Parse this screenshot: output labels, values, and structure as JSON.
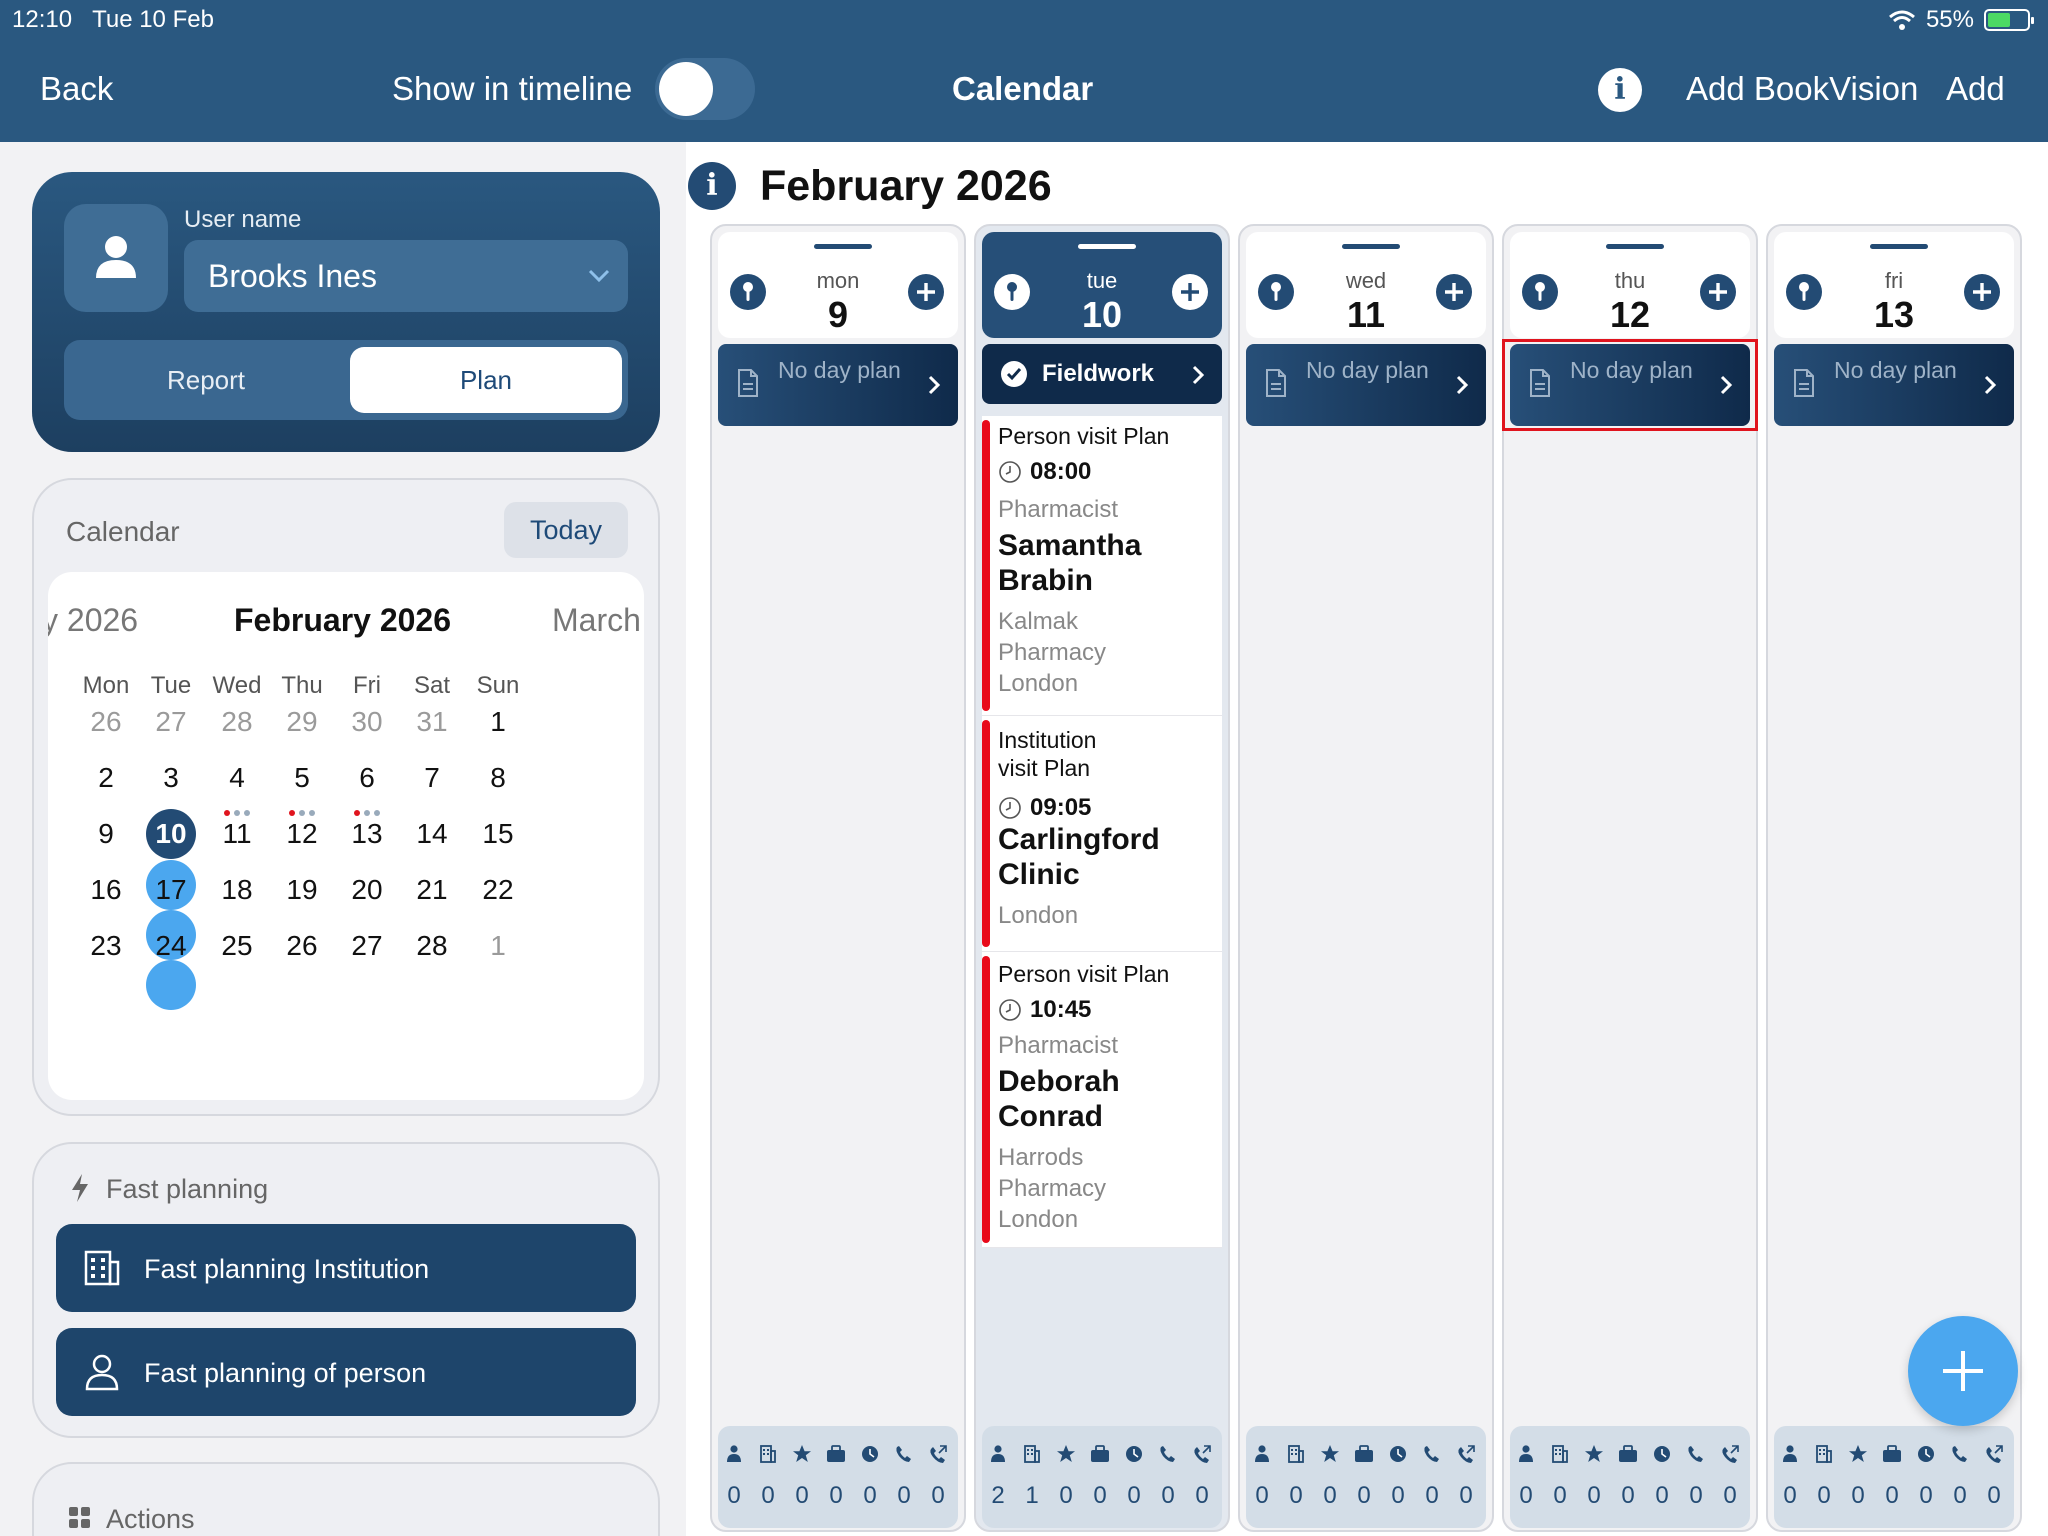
{
  "status_bar": {
    "time": "12:10",
    "date": "Tue 10 Feb",
    "battery": "55%"
  },
  "nav": {
    "back": "Back",
    "show_in_timeline": "Show in timeline",
    "title": "Calendar",
    "add_bookvision": "Add BookVision",
    "add": "Add"
  },
  "user_card": {
    "label": "User name",
    "value": "Brooks Ines",
    "segments": [
      "Report",
      "Plan"
    ],
    "selected_segment": "Plan"
  },
  "calendar_card": {
    "title": "Calendar",
    "today_button": "Today",
    "prev_month": "y 2026",
    "current_month": "February 2026",
    "next_month": "March",
    "weekdays": [
      "Mon",
      "Tue",
      "Wed",
      "Thu",
      "Fri",
      "Sat",
      "Sun"
    ],
    "weeks": [
      [
        "26",
        "27",
        "28",
        "29",
        "30",
        "31",
        "1"
      ],
      [
        "2",
        "3",
        "4",
        "5",
        "6",
        "7",
        "8"
      ],
      [
        "9",
        "10",
        "11",
        "12",
        "13",
        "14",
        "15"
      ],
      [
        "16",
        "17",
        "18",
        "19",
        "20",
        "21",
        "22"
      ],
      [
        "23",
        "24",
        "25",
        "26",
        "27",
        "28",
        "1"
      ]
    ]
  },
  "fast_planning": {
    "title": "Fast planning",
    "institution_button": "Fast planning Institution",
    "person_button": "Fast planning of person"
  },
  "actions": {
    "title": "Actions"
  },
  "week_view": {
    "title": "February 2026",
    "days": [
      {
        "weekday": "mon",
        "num": "9",
        "plan": "No day plan",
        "stats": [
          "0",
          "0",
          "0",
          "0",
          "0",
          "0",
          "0"
        ]
      },
      {
        "weekday": "tue",
        "num": "10",
        "plan": "Fieldwork",
        "stats": [
          "2",
          "1",
          "0",
          "0",
          "0",
          "0",
          "0"
        ]
      },
      {
        "weekday": "wed",
        "num": "11",
        "plan": "No day plan",
        "stats": [
          "0",
          "0",
          "0",
          "0",
          "0",
          "0",
          "0"
        ]
      },
      {
        "weekday": "thu",
        "num": "12",
        "plan": "No day plan",
        "stats": [
          "0",
          "0",
          "0",
          "0",
          "0",
          "0",
          "0"
        ]
      },
      {
        "weekday": "fri",
        "num": "13",
        "plan": "No day plan",
        "stats": [
          "0",
          "0",
          "0",
          "0",
          "0",
          "0",
          "0"
        ]
      }
    ],
    "visits": [
      {
        "type": "Person visit Plan",
        "time": "08:00",
        "role": "Pharmacist",
        "name": "Samantha Brabin",
        "place": "Kalmak Pharmacy London"
      },
      {
        "type": "Institution visit Plan",
        "time": "09:05",
        "role": "",
        "name": "Carlingford Clinic",
        "place": "London"
      },
      {
        "type": "Person visit Plan",
        "time": "10:45",
        "role": "Pharmacist",
        "name": "Deborah Conrad",
        "place": "Harrods Pharmacy London"
      }
    ]
  },
  "stat_icons": [
    "person-icon",
    "building-icon",
    "star-icon",
    "briefcase-icon",
    "clock-icon",
    "phone-icon",
    "phone-outgoing-icon"
  ],
  "colors": {
    "header": "#2a5880",
    "accent": "#234b74",
    "visit_bar": "#e8091a",
    "fab": "#4ba7ef",
    "highlight": "#e0141e"
  }
}
